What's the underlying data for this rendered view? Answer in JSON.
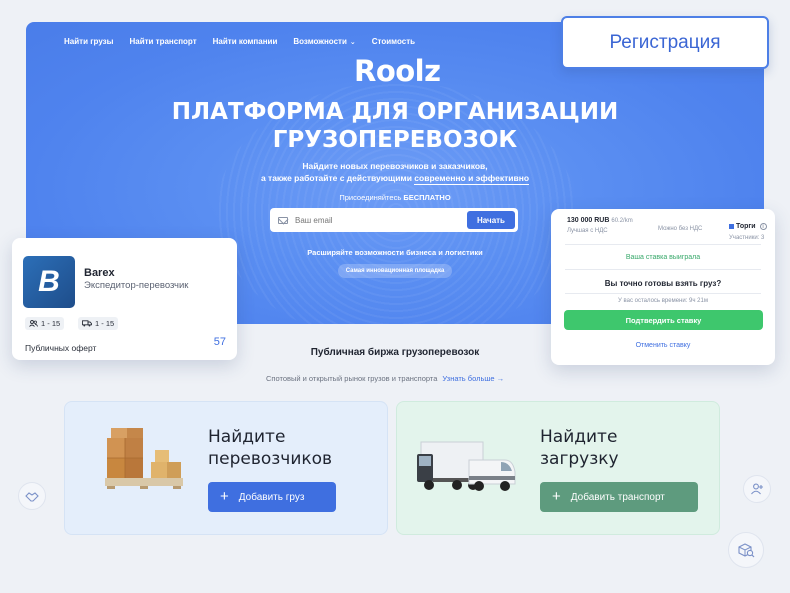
{
  "nav": {
    "items": [
      "Найти грузы",
      "Найти транспорт",
      "Найти компании",
      "Возможности",
      "Стоимость"
    ]
  },
  "brand": {
    "logo": "Roolz"
  },
  "hero": {
    "title_line1": "ПЛАТФОРМА ДЛЯ ОРГАНИЗАЦИИ",
    "title_line2": "ГРУЗОПЕРЕВОЗОК",
    "subtitle_line1": "Найдите новых перевозчиков и заказчиков,",
    "subtitle_line2_pre": "а также работайте с действующими ",
    "subtitle_line2_ul": "современно и эффективно",
    "join_pre": "Присоединяйтесь ",
    "join_bold": "БЕСПЛАТНО",
    "email_placeholder": "Ваш email",
    "start_button": "Начать",
    "expand_text": "Расширяйте возможности бизнеса и логистики",
    "pill_text": "Самая инновационная площадка"
  },
  "register_button": "Регистрация",
  "company_card": {
    "logo_letter": "B",
    "name": "Barex",
    "type": "Экспедитор-перевозчик",
    "employees": "1 - 15",
    "trucks": "1 - 15",
    "public_offers_label": "Публичных оферт",
    "public_offers_count": "57"
  },
  "bid_card": {
    "price": "130 000 RUB",
    "per_km": "60.2/km",
    "vat_best": "Лучшая с НДС",
    "vat_possible": "Можно без НДС",
    "torgi": "Торги",
    "participants": "Участники: 3",
    "won_text": "Ваша ставка выиграла",
    "question": "Вы точно готовы взять груз?",
    "time_left": "У вас осталось времени: 9ч 21м",
    "confirm_button": "Подтвердить ставку",
    "cancel_link": "Отменить ставку"
  },
  "exchange": {
    "title": "Публичная биржа грузоперевозок",
    "subtitle": "Спотовый и открытый рынок грузов и транспорта",
    "learn_more": "Узнать больше"
  },
  "cards": {
    "carriers": {
      "title_line1": "Найдите",
      "title_line2": "перевозчиков",
      "button": "Добавить груз"
    },
    "cargo": {
      "title_line1": "Найдите",
      "title_line2": "загрузку",
      "button": "Добавить транспорт"
    }
  },
  "colors": {
    "accent": "#3f6fe0",
    "hero_bg": "#5b8ff2",
    "green": "#3ec76d"
  },
  "icons": [
    "mail-icon",
    "users-icon",
    "truck-icon",
    "arrow-right-icon",
    "plus-icon",
    "handshake-icon",
    "add-user-icon",
    "box-search-icon",
    "info-icon",
    "chevron-down-icon"
  ]
}
